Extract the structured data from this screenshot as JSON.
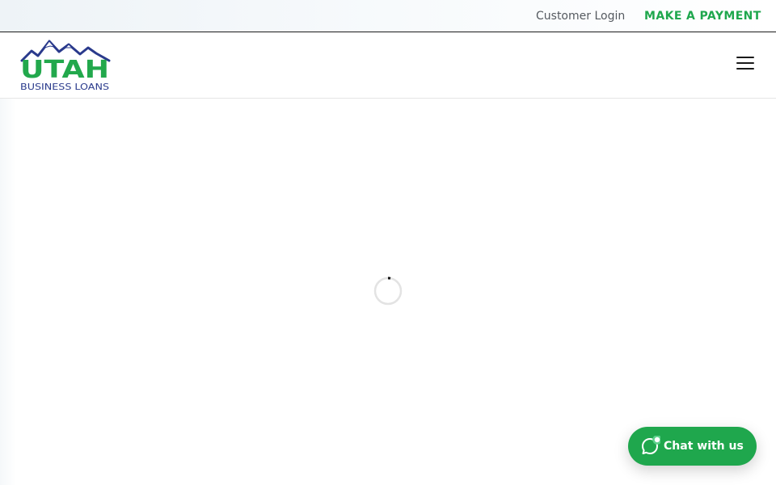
{
  "topbar": {
    "customer_login": "Customer Login",
    "make_payment": "MAKE A PAYMENT"
  },
  "logo": {
    "word": "UTAH",
    "tagline": "BUSINESS LOANS",
    "icon": "mountain-logo",
    "colors": {
      "word": "#22a84c",
      "tagline": "#2a3a8c",
      "mountains": "#2a3a8c"
    }
  },
  "header": {
    "menu_icon": "hamburger-menu-icon"
  },
  "main": {
    "loading_icon": "loading-spinner-icon"
  },
  "chat": {
    "label": "Chat with us",
    "icon": "chat-bubble-icon",
    "status": "online-indicator",
    "color": "#1fa74d"
  },
  "colors": {
    "accent": "#1fa74d",
    "link": "#555a60",
    "topbar_bg": "#eef3f7"
  }
}
